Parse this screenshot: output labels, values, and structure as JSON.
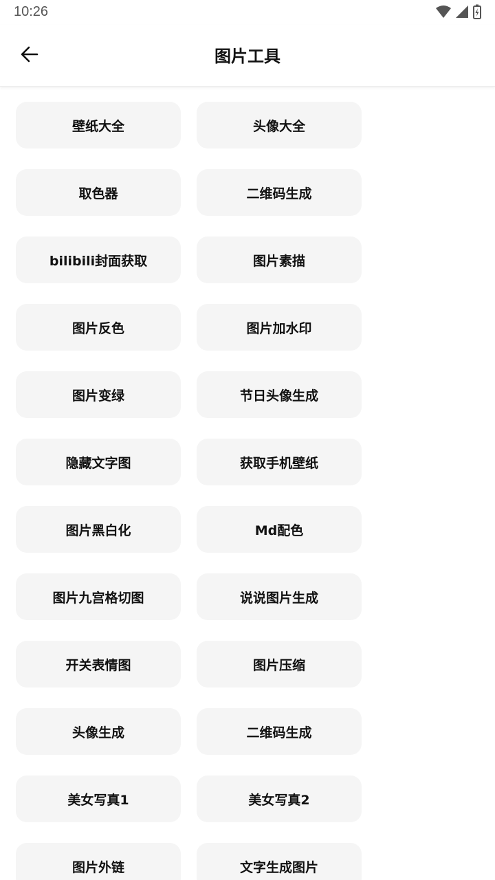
{
  "status_bar": {
    "time": "10:26"
  },
  "header": {
    "title": "图片工具"
  },
  "tools": [
    "壁纸大全",
    "头像大全",
    "取色器",
    "二维码生成",
    "bilibili封面获取",
    "图片素描",
    "图片反色",
    "图片加水印",
    "图片变绿",
    "节日头像生成",
    "隐藏文字图",
    "获取手机壁纸",
    "图片黑白化",
    "Md配色",
    "图片九宫格切图",
    "说说图片生成",
    "开关表情图",
    "图片压缩",
    "头像生成",
    "二维码生成",
    "美女写真1",
    "美女写真2",
    "图片外链",
    "文字生成图片"
  ]
}
